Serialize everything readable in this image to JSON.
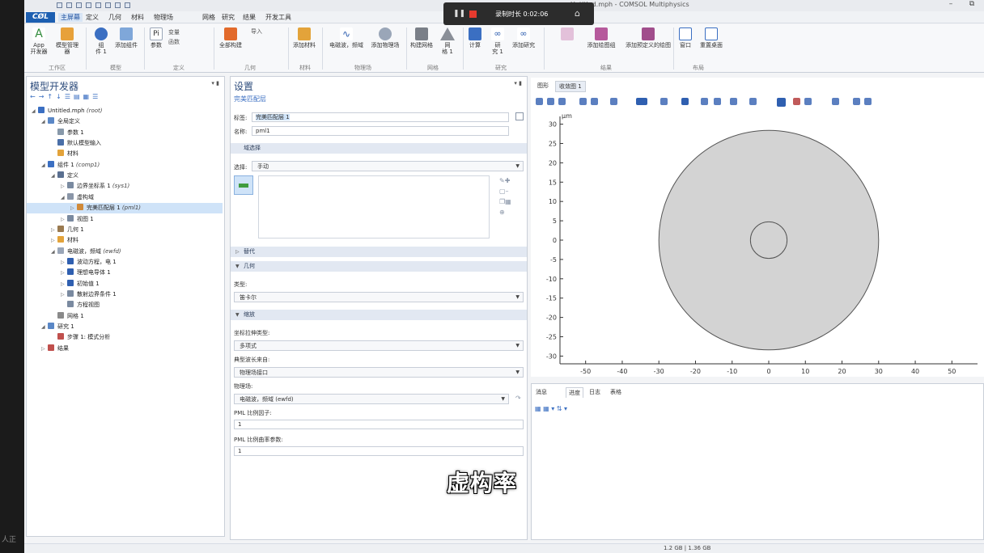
{
  "window": {
    "title": "Untitled.mph - COMSOL Multiphysics"
  },
  "left_strip_text": "人正",
  "menu": {
    "tabs": [
      {
        "label": "主屏幕"
      },
      {
        "label": "定义"
      },
      {
        "label": "几何"
      },
      {
        "label": "材料"
      },
      {
        "label": "物理场"
      },
      {
        "label": "网格"
      },
      {
        "label": "研究"
      },
      {
        "label": "结果"
      },
      {
        "label": "开发工具"
      }
    ]
  },
  "recording": {
    "time": "录制时长 0:02:06"
  },
  "ribbon": {
    "buttons": [
      {
        "label": "App\n开发器",
        "icon": "app-builder-icon"
      },
      {
        "label": "模型管理器",
        "icon": "model-manager-icon"
      },
      {
        "label": "组\n件 1",
        "icon": "component-icon"
      },
      {
        "label": "添加组件",
        "icon": "add-component-icon"
      },
      {
        "label": "参数",
        "icon": "parameters-icon"
      },
      {
        "label": "全部构建",
        "icon": "build-all-icon"
      },
      {
        "label": "添加材料",
        "icon": "add-material-icon"
      },
      {
        "label": "电磁波，频域",
        "icon": "ewfd-icon"
      },
      {
        "label": "添加物理场",
        "icon": "add-physics-icon"
      },
      {
        "label": "构建网格",
        "icon": "build-mesh-icon"
      },
      {
        "label": "网\n格 1",
        "icon": "mesh-icon"
      },
      {
        "label": "计算",
        "icon": "compute-icon"
      },
      {
        "label": "研\n究 1",
        "icon": "study-icon"
      },
      {
        "label": "添加研究",
        "icon": "add-study-icon"
      },
      {
        "label": "添加绘图组",
        "icon": "add-plot-group-icon"
      },
      {
        "label": "添加预定义的绘图",
        "icon": "add-predefined-plot-icon"
      },
      {
        "label": "窗口",
        "icon": "windows-icon"
      },
      {
        "label": "重置桌面",
        "icon": "reset-desktop-icon"
      }
    ],
    "small_items": [
      "导入",
      "变量",
      "函数"
    ],
    "groups": [
      {
        "label": "工作区"
      },
      {
        "label": "模型"
      },
      {
        "label": "定义"
      },
      {
        "label": "几何"
      },
      {
        "label": "材料"
      },
      {
        "label": "物理场"
      },
      {
        "label": "网格"
      },
      {
        "label": "研究"
      },
      {
        "label": "结果"
      },
      {
        "label": "布局"
      }
    ]
  },
  "model_builder": {
    "title": "模型开发器",
    "tree": [
      {
        "label": "Untitled.mph",
        "tag": "(root)",
        "level": 0,
        "toggle": "◢",
        "color": "#3b6fc2"
      },
      {
        "label": "全局定义",
        "tag": "",
        "level": 1,
        "toggle": "◢",
        "color": "#5a87c6"
      },
      {
        "label": "参数 1",
        "tag": "",
        "level": 2,
        "toggle": "",
        "color": "#8899aa"
      },
      {
        "label": "默认模型输入",
        "tag": "",
        "level": 2,
        "toggle": "",
        "color": "#4a6fa8"
      },
      {
        "label": "材料",
        "tag": "",
        "level": 2,
        "toggle": "",
        "color": "#e3a33a"
      },
      {
        "label": "组件 1",
        "tag": "(comp1)",
        "level": 1,
        "toggle": "◢",
        "color": "#3b6fc2"
      },
      {
        "label": "定义",
        "tag": "",
        "level": 2,
        "toggle": "◢",
        "color": "#5a6f90"
      },
      {
        "label": "边界坐标系 1",
        "tag": "(sys1)",
        "level": 3,
        "toggle": "▷",
        "color": "#7a8aa0"
      },
      {
        "label": "虚构域",
        "tag": "",
        "level": 3,
        "toggle": "◢",
        "color": "#8a96a8"
      },
      {
        "label": "完美匹配层 1",
        "tag": "(pml1)",
        "level": 4,
        "toggle": "▷",
        "color": "#d08a3a",
        "selected": true
      },
      {
        "label": "视图 1",
        "tag": "",
        "level": 3,
        "toggle": "▷",
        "color": "#7a8aa0"
      },
      {
        "label": "几何 1",
        "tag": "",
        "level": 2,
        "toggle": "▷",
        "color": "#9a7a50"
      },
      {
        "label": "材料",
        "tag": "",
        "level": 2,
        "toggle": "▷",
        "color": "#e3a33a"
      },
      {
        "label": "电磁波，频域",
        "tag": "(ewfd)",
        "level": 2,
        "toggle": "◢",
        "color": "#9aa6b8"
      },
      {
        "label": "波动方程，电 1",
        "tag": "",
        "level": 3,
        "toggle": "▷",
        "color": "#2f5fb0"
      },
      {
        "label": "理想电导体 1",
        "tag": "",
        "level": 3,
        "toggle": "▷",
        "color": "#2f5fb0"
      },
      {
        "label": "初始值 1",
        "tag": "",
        "level": 3,
        "toggle": "▷",
        "color": "#2f5fb0"
      },
      {
        "label": "散射边界条件 1",
        "tag": "",
        "level": 3,
        "toggle": "▷",
        "color": "#7a8aa0"
      },
      {
        "label": "方程视图",
        "tag": "",
        "level": 3,
        "toggle": "",
        "color": "#7a8aa0"
      },
      {
        "label": "网格 1",
        "tag": "",
        "level": 2,
        "toggle": "",
        "color": "#8a8a8a"
      },
      {
        "label": "研究 1",
        "tag": "",
        "level": 1,
        "toggle": "◢",
        "color": "#5a87c6"
      },
      {
        "label": "步骤 1: 模式分析",
        "tag": "",
        "level": 2,
        "toggle": "",
        "color": "#c0504d"
      },
      {
        "label": "结果",
        "tag": "",
        "level": 1,
        "toggle": "▷",
        "color": "#c0504d"
      }
    ]
  },
  "settings": {
    "title": "设置",
    "subtitle": "完美匹配层",
    "label_caption": "标签:",
    "label_value": "完美匹配层 1",
    "name_caption": "名称:",
    "name_value": "pml1",
    "domain_section": "域选择",
    "selection_caption": "选择:",
    "selection_value": "手动",
    "override_section": "替代",
    "geometry_section": "几何",
    "type_caption": "类型:",
    "type_value": "笛卡尔",
    "scaling_section": "缩放",
    "stretch_caption": "坐标拉伸类型:",
    "stretch_value": "多项式",
    "wavelength_caption": "典型波长来自:",
    "wavelength_value": "物理场接口",
    "physics_caption": "物理场:",
    "physics_value": "电磁波，频域 (ewfd)",
    "pml_scale_caption": "PML 比例因子:",
    "pml_scale_value": "1",
    "pml_curv_caption": "PML 比例曲率参数:",
    "pml_curv_value": "1"
  },
  "graphics_tabs": [
    {
      "label": "图形"
    },
    {
      "label": "收敛图 1"
    }
  ],
  "message_tabs": [
    {
      "label": "消息"
    },
    {
      "label": "进度"
    },
    {
      "label": "日志"
    },
    {
      "label": "表格"
    }
  ],
  "subtitle_caption": "虚构率",
  "status": {
    "memory": "1.2 GB | 1.36 GB"
  },
  "chart_data": {
    "type": "geometry",
    "unit_label": "μm",
    "x_ticks": [
      -50,
      -40,
      -30,
      -20,
      -10,
      0,
      10,
      20,
      30,
      40,
      50
    ],
    "y_ticks": [
      30,
      25,
      20,
      15,
      10,
      5,
      0,
      -5,
      -10,
      -15,
      -20,
      -25,
      -30
    ],
    "xlim": [
      -57,
      57
    ],
    "ylim": [
      -32,
      32
    ],
    "shapes": [
      {
        "kind": "circle",
        "cx": 0,
        "cy": 0,
        "r": 30,
        "fill": "#d3d3d3",
        "stroke": "#555555"
      },
      {
        "kind": "circle",
        "cx": 0,
        "cy": 0,
        "r": 5,
        "fill": "none",
        "stroke": "#555555"
      }
    ]
  }
}
